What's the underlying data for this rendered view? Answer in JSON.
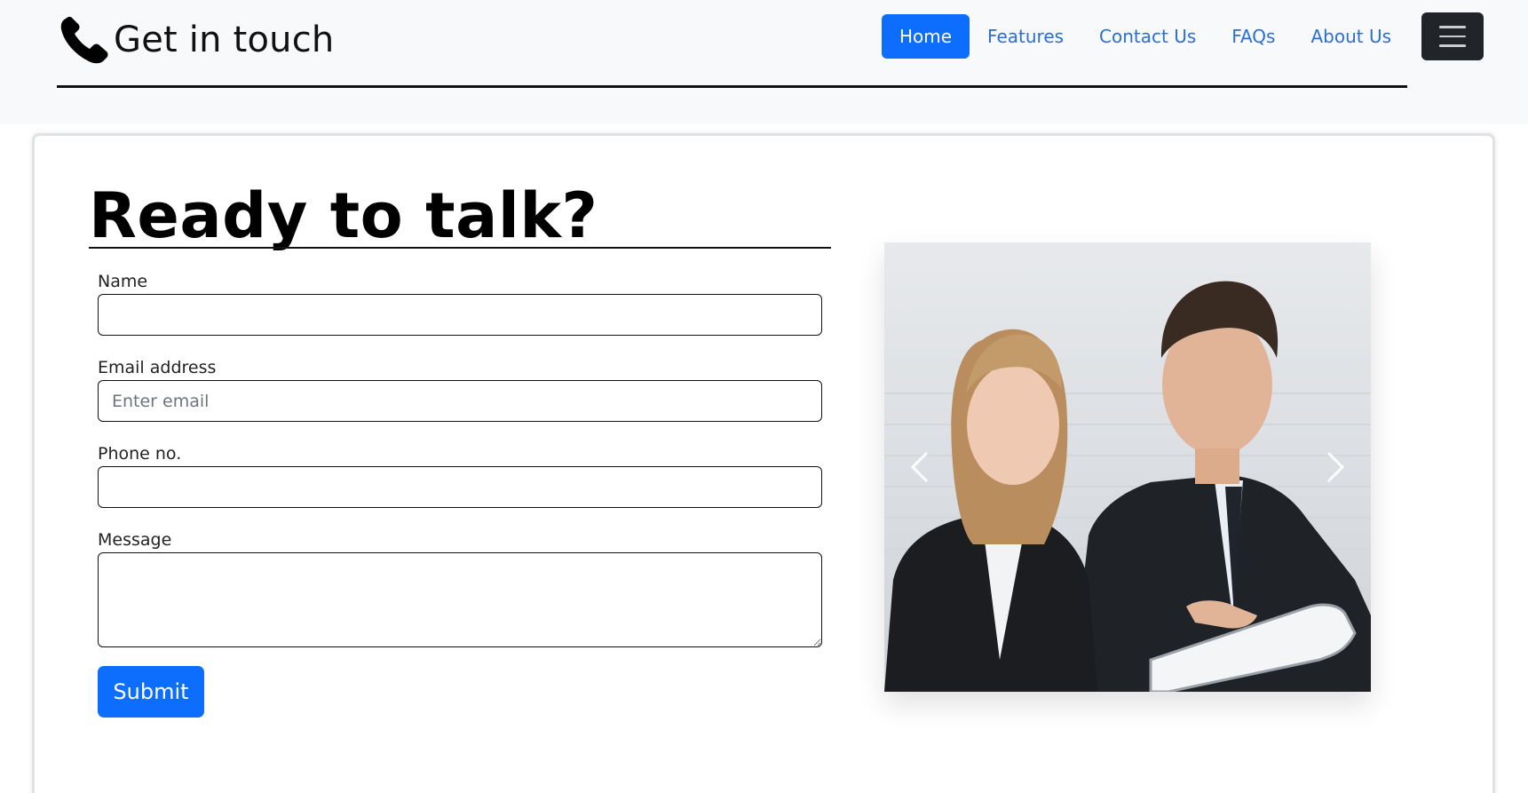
{
  "header": {
    "brand_icon": "phone-icon",
    "brand_text": "Get in touch",
    "nav": [
      {
        "label": "Home",
        "active": true
      },
      {
        "label": "Features"
      },
      {
        "label": "Contact Us"
      },
      {
        "label": "FAQs"
      },
      {
        "label": "About Us"
      }
    ],
    "menu_icon": "hamburger-menu-icon"
  },
  "form": {
    "heading": "Ready to talk?",
    "fields": {
      "name": {
        "label": "Name",
        "value": "",
        "placeholder": ""
      },
      "email": {
        "label": "Email address",
        "value": "",
        "placeholder": "Enter email"
      },
      "phone": {
        "label": "Phone no.",
        "value": "",
        "placeholder": ""
      },
      "message": {
        "label": "Message",
        "value": "",
        "placeholder": ""
      }
    },
    "submit_label": "Submit"
  },
  "carousel": {
    "image": "photo of a smiling businesswoman and businessman looking at a tablet",
    "prev_icon": "chevron-left-icon",
    "next_icon": "chevron-right-icon"
  },
  "colors": {
    "primary": "#0d6efd",
    "link": "#2a6fd6",
    "navbar_bg": "#f8f9fa",
    "toggler_bg": "#212529"
  }
}
